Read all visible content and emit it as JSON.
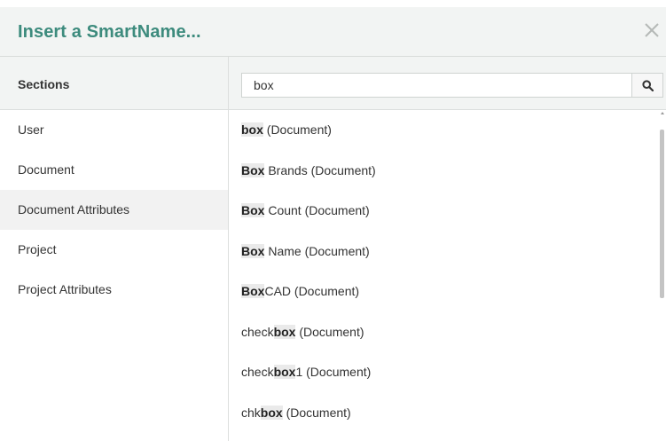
{
  "dialog": {
    "title": "Insert a SmartName...",
    "close_icon": "close-icon"
  },
  "sections": {
    "heading": "Sections",
    "items": [
      {
        "label": "User",
        "active": false
      },
      {
        "label": "Document",
        "active": false
      },
      {
        "label": "Document Attributes",
        "active": true
      },
      {
        "label": "Project",
        "active": false
      },
      {
        "label": "Project Attributes",
        "active": false
      }
    ]
  },
  "search": {
    "value": "box",
    "button_icon": "search-icon"
  },
  "results": [
    {
      "prefix": "",
      "match": "box",
      "suffix": " (Document)"
    },
    {
      "prefix": "",
      "match": "Box",
      "suffix": " Brands (Document)"
    },
    {
      "prefix": "",
      "match": "Box",
      "suffix": " Count (Document)"
    },
    {
      "prefix": "",
      "match": "Box",
      "suffix": " Name (Document)"
    },
    {
      "prefix": "",
      "match": "Box",
      "suffix": "CAD (Document)"
    },
    {
      "prefix": "check",
      "match": "box",
      "suffix": " (Document)"
    },
    {
      "prefix": "check",
      "match": "box",
      "suffix": "1 (Document)"
    },
    {
      "prefix": "chk",
      "match": "box",
      "suffix": " (Document)"
    }
  ],
  "colors": {
    "title": "#3d8b7d",
    "header_bg": "#f2f4f3",
    "active_bg": "#f2f2f2"
  }
}
